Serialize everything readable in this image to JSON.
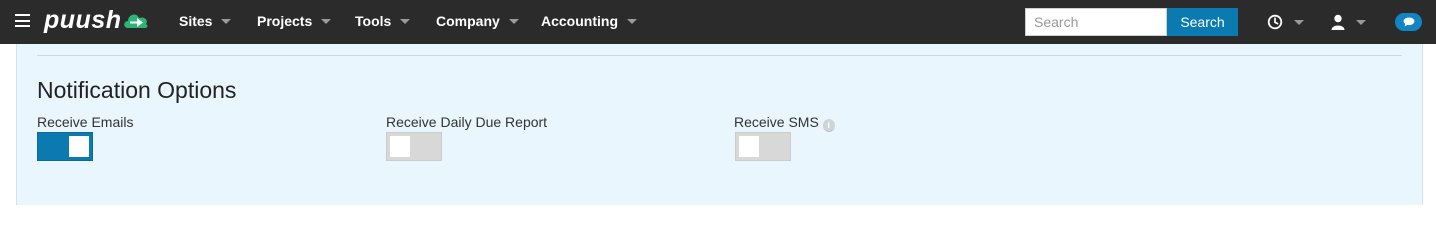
{
  "topbar": {
    "logo_text": "puush",
    "nav": [
      {
        "label": "Sites"
      },
      {
        "label": "Projects"
      },
      {
        "label": "Tools"
      },
      {
        "label": "Company"
      },
      {
        "label": "Accounting"
      }
    ],
    "search": {
      "placeholder": "Search",
      "value": "",
      "button_label": "Search"
    },
    "icons": [
      "menu-icon",
      "clock-icon",
      "user-icon",
      "chat-icon"
    ],
    "colors": {
      "bar": "#2b2b2b",
      "accent": "#0b7ab0",
      "logo_arrow": "#2bb673"
    }
  },
  "notifications": {
    "title": "Notification Options",
    "options": [
      {
        "label": "Receive Emails",
        "enabled": true
      },
      {
        "label": "Receive Daily Due Report",
        "enabled": false
      },
      {
        "label": "Receive SMS",
        "enabled": false,
        "info_icon": "info-icon"
      }
    ]
  }
}
